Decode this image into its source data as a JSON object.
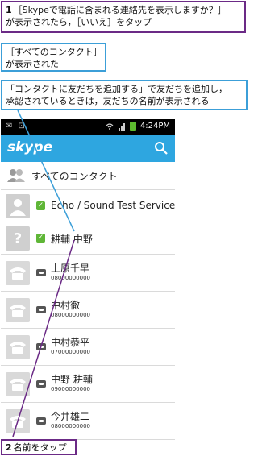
{
  "callouts": {
    "step1_number": "1",
    "step1_text_line1": "［Skypeで電話に含まれる連絡先を表示しますか？］",
    "step1_text_line2": "が表示されたら，［いいえ］をタップ",
    "all_contacts_line1": "［すべてのコンタクト］",
    "all_contacts_line2": "が表示された",
    "add_friends_line1": "「コンタクトに友だちを追加する」で友だちを追加し，",
    "add_friends_line2": "承認されているときは，友だちの名前が表示される",
    "step2_number": "2",
    "step2_text": "名前をタップ"
  },
  "statusbar": {
    "left_icons": "✉ ⊡",
    "time": "4:24PM"
  },
  "app": {
    "logo": "skype"
  },
  "contacts": {
    "header": "すべてのコンタクト",
    "items": [
      {
        "name": "Echo / Sound Test Service",
        "number": ""
      },
      {
        "name": "耕輔 中野",
        "number": ""
      },
      {
        "name": "上原千早",
        "number": "08000000000"
      },
      {
        "name": "中村徹",
        "number": "08000000000"
      },
      {
        "name": "中村恭平",
        "number": "07000000000"
      },
      {
        "name": "中野 耕輔",
        "number": "09000000000"
      },
      {
        "name": "今井雄二",
        "number": "08000000000"
      }
    ]
  },
  "colors": {
    "skype_blue": "#2ea6e0",
    "callout_purple": "#6b2a86",
    "callout_blue": "#3c9fd8",
    "online_green": "#5fb637"
  }
}
